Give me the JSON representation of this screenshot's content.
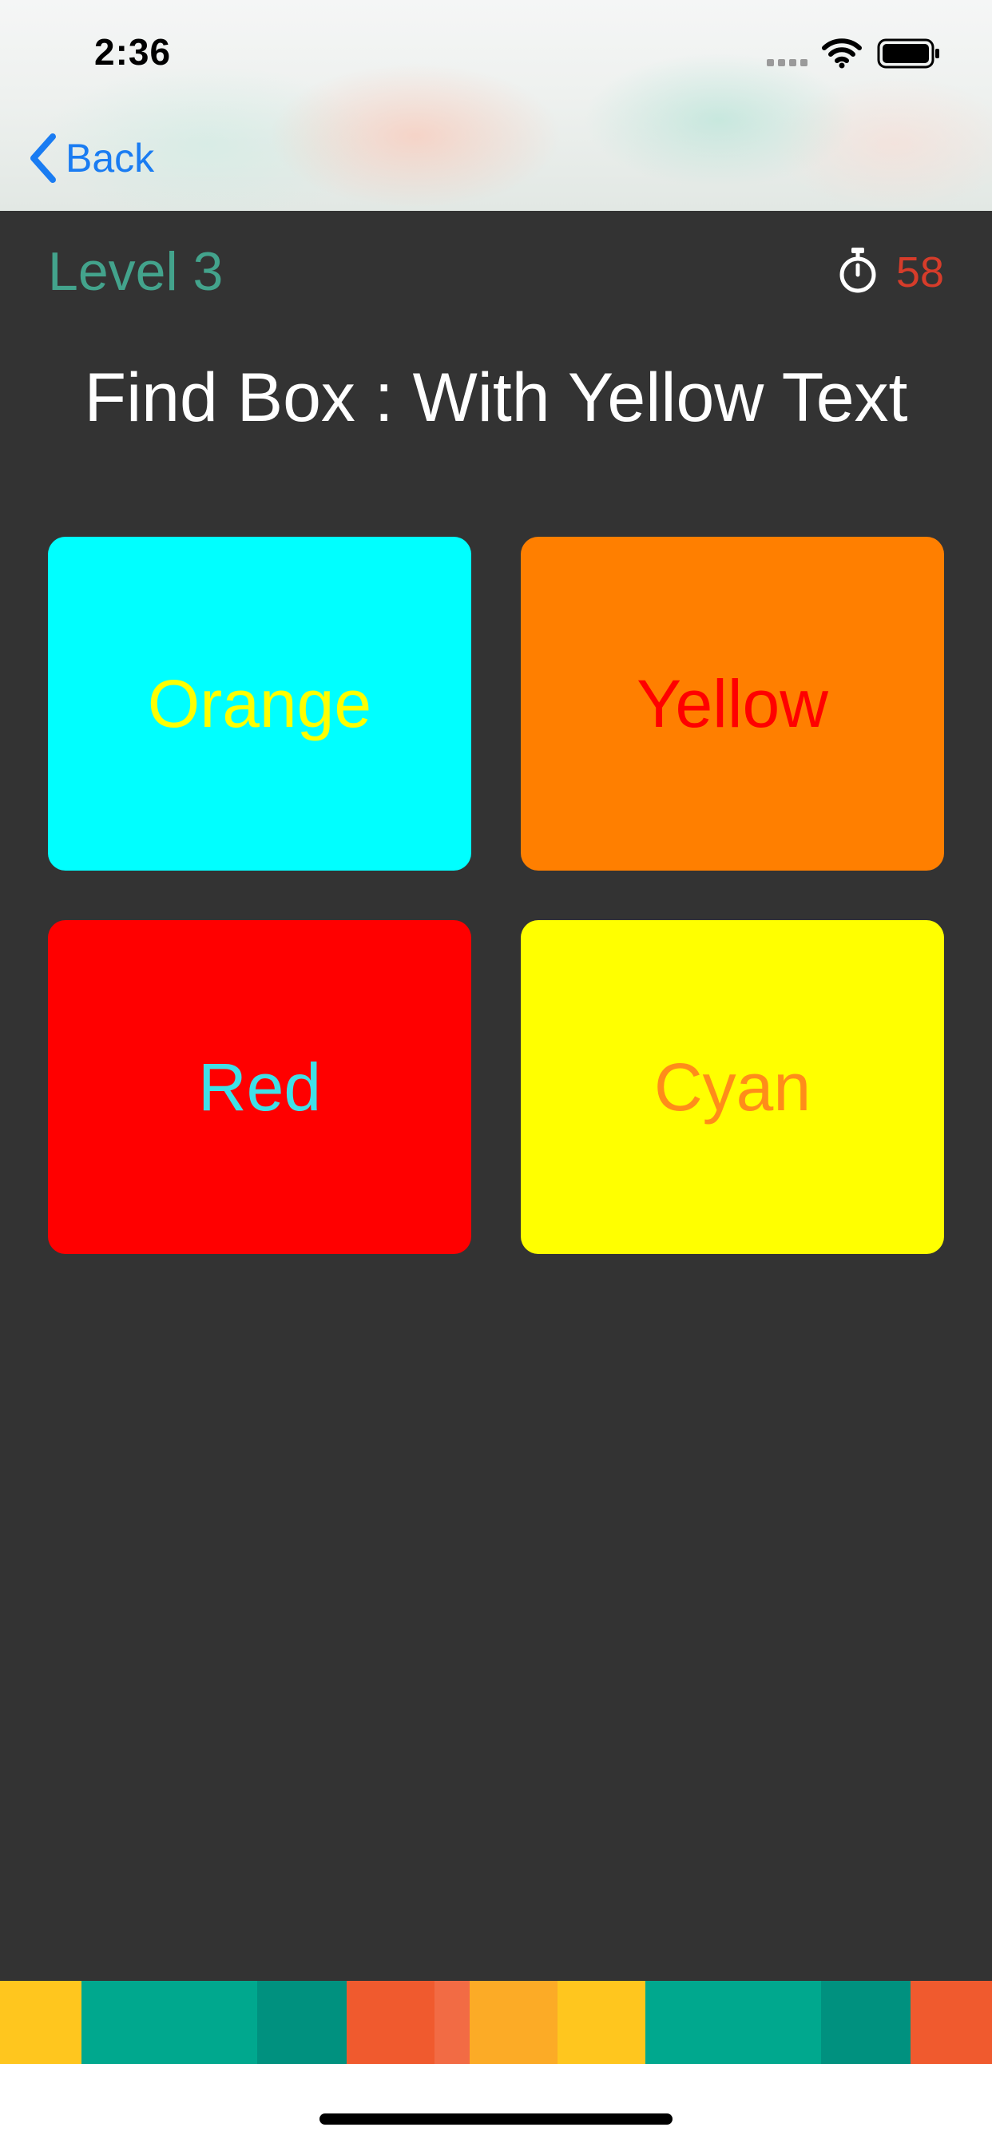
{
  "status_bar": {
    "time": "2:36"
  },
  "nav": {
    "back_label": "Back"
  },
  "game": {
    "level_label": "Level 3",
    "time_left": "58",
    "prompt": "Find Box : With Yellow Text",
    "boxes": [
      {
        "label": "Orange",
        "bg_color": "#00FFFF",
        "text_color": "#FFFF00"
      },
      {
        "label": "Yellow",
        "bg_color": "#FF7F00",
        "text_color": "#FF0000"
      },
      {
        "label": "Red",
        "bg_color": "#FF0000",
        "text_color": "#3FE0E8"
      },
      {
        "label": "Cyan",
        "bg_color": "#FFFF00",
        "text_color": "#FF8C1A"
      }
    ]
  },
  "colors": {
    "background": "#333333",
    "level": "#43A38C",
    "timer_value": "#D63C2A",
    "accent_link": "#1A7CF2",
    "footer_stripes": [
      "#FFC61E",
      "#00A88E",
      "#00A88E",
      "#00917F",
      "#F05A2E",
      "#F26B44",
      "#FCAB26",
      "#FFC61E",
      "#00A88E",
      "#00A88E",
      "#00917F",
      "#F05A2E"
    ]
  }
}
